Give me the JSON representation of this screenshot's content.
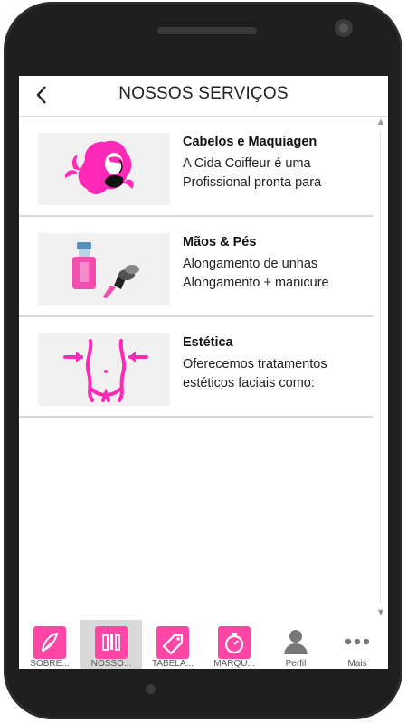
{
  "header": {
    "back_icon": "chevron-left-icon",
    "title": "NOSSOS SERVIÇOS"
  },
  "services": [
    {
      "title": "Cabelos e Maquiagen",
      "description": "A Cida Coiffeur  é uma\nProfissional pronta para",
      "icon": "hair-makeup-icon"
    },
    {
      "title": "Mãos & Pés",
      "description": "Alongamento de unhas\nAlongamento + manicure",
      "icon": "nail-polish-icon"
    },
    {
      "title": "Estética",
      "description": "Oferecemos tratamentos\nestéticos faciais como:",
      "icon": "body-waist-icon"
    }
  ],
  "tabbar": {
    "tabs": [
      {
        "label": "SOBRE...",
        "icon": "feather-icon"
      },
      {
        "label": "NOSSO...",
        "icon": "beauty-tools-icon",
        "active": true
      },
      {
        "label": "TABELA...",
        "icon": "tag-icon"
      },
      {
        "label": "MARQU...",
        "icon": "stopwatch-icon"
      },
      {
        "label": "Perfil",
        "icon": "user-icon"
      },
      {
        "label": "Mais",
        "icon": "more-dots-icon"
      }
    ]
  },
  "colors": {
    "accent": "#ff45a6",
    "phone_body": "#1e1e1e",
    "active_tab_bg": "#d9d9d9"
  }
}
